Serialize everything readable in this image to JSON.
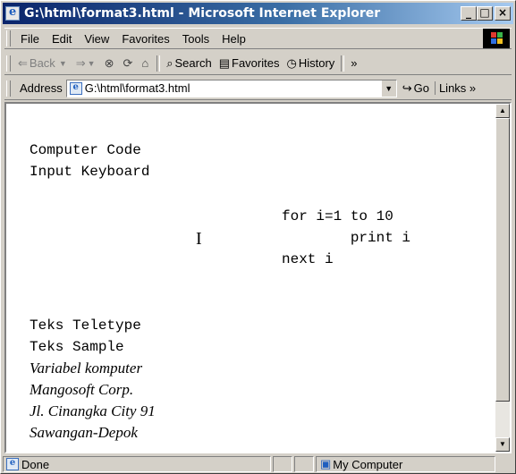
{
  "window": {
    "title": "G:\\html\\format3.html - Microsoft Internet Explorer",
    "min_label": "_",
    "max_label": "□",
    "close_label": "×"
  },
  "menu": {
    "items": [
      "File",
      "Edit",
      "View",
      "Favorites",
      "Tools",
      "Help"
    ]
  },
  "toolbar": {
    "back_label": "Back",
    "search_label": "Search",
    "favorites_label": "Favorites",
    "history_label": "History",
    "more_label": "»"
  },
  "address": {
    "label": "Address",
    "value": "G:\\html\\format3.html",
    "go_label": "Go",
    "links_label": "Links »"
  },
  "content": {
    "code_line": "Computer Code",
    "keyboard_line": "Input Keyboard",
    "pre_lines": [
      "for i=1 to 10",
      "        print i",
      "next i"
    ],
    "tt_line": "Teks Teletype",
    "samp_line": "Teks Sample",
    "var_line": "Variabel komputer",
    "address_lines": [
      "Mangosoft Corp.",
      "Jl. Cinangka City 91",
      "Sawangan-Depok"
    ]
  },
  "status": {
    "left_text": "Done",
    "zone_text": "My Computer"
  },
  "colors": {
    "titlebar_start": "#0a246a",
    "titlebar_end": "#a6caf0",
    "chrome": "#d4d0c8"
  }
}
